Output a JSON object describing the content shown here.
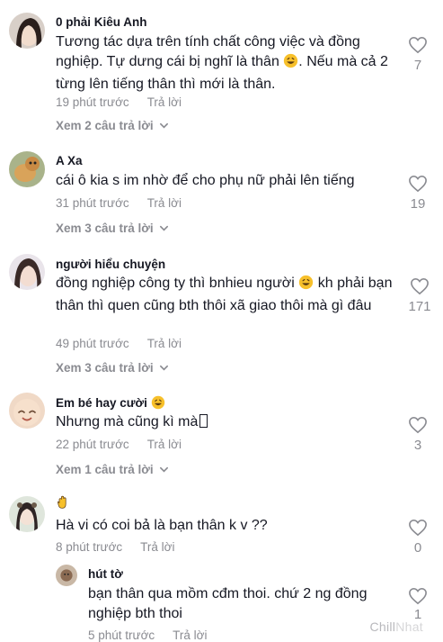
{
  "comments": [
    {
      "username": "0 phải Kiêu Anh",
      "text_parts": [
        "Tương tác dựa trên tính chất công việc và đồng nghiệp. Tự dưng cái bị nghĩ là thân ",
        ". Nếu mà cả 2 từng lên tiếng thân thì mới là thân."
      ],
      "time": "19 phút trước",
      "reply_label": "Trả lời",
      "likes": "7",
      "view_replies": "Xem 2 câu trả lời"
    },
    {
      "username": "A Xa",
      "text": "cái ô kia s im nhờ để cho phụ nữ phải lên tiếng",
      "time": "31 phút trước",
      "reply_label": "Trả lời",
      "likes": "19",
      "view_replies": "Xem 3 câu trả lời"
    },
    {
      "username": "người hiểu chuyện",
      "text_parts": [
        "đồng nghiệp công ty thì bnhieu người ",
        " kh phải bạn thân thì quen cũng bth thôi xã giao thôi mà gì đâu"
      ],
      "time": "49 phút trước",
      "reply_label": "Trả lời",
      "likes": "171",
      "view_replies": "Xem 3 câu trả lời"
    },
    {
      "username": "Em bé hay cười",
      "text": "Nhưng mà cũng kì mà",
      "time": "22 phút trước",
      "reply_label": "Trả lời",
      "likes": "3",
      "view_replies": "Xem 1 câu trả lời"
    },
    {
      "username": "",
      "text": "Hà vi có coi bả là bạn thân k v ??",
      "time": "8 phút trước",
      "reply_label": "Trả lời",
      "likes": "0"
    }
  ],
  "reply": {
    "username": "hút tờ",
    "text": "bạn thân qua mồm cđm thoi. chứ 2 ng đồng nghiệp bth thoi",
    "time": "5 phút trước",
    "reply_label": "Trả lời",
    "likes": "1"
  },
  "watermark": {
    "part1": "Chill",
    "part2": "Nhat"
  },
  "icons": {
    "like": "heart-outline-icon",
    "expand": "chevron-down-icon",
    "laugh": "grinning-sweat-emoji",
    "hand": "hand-emoji"
  },
  "colors": {
    "text": "#161823",
    "muted": "#8a8b91"
  }
}
